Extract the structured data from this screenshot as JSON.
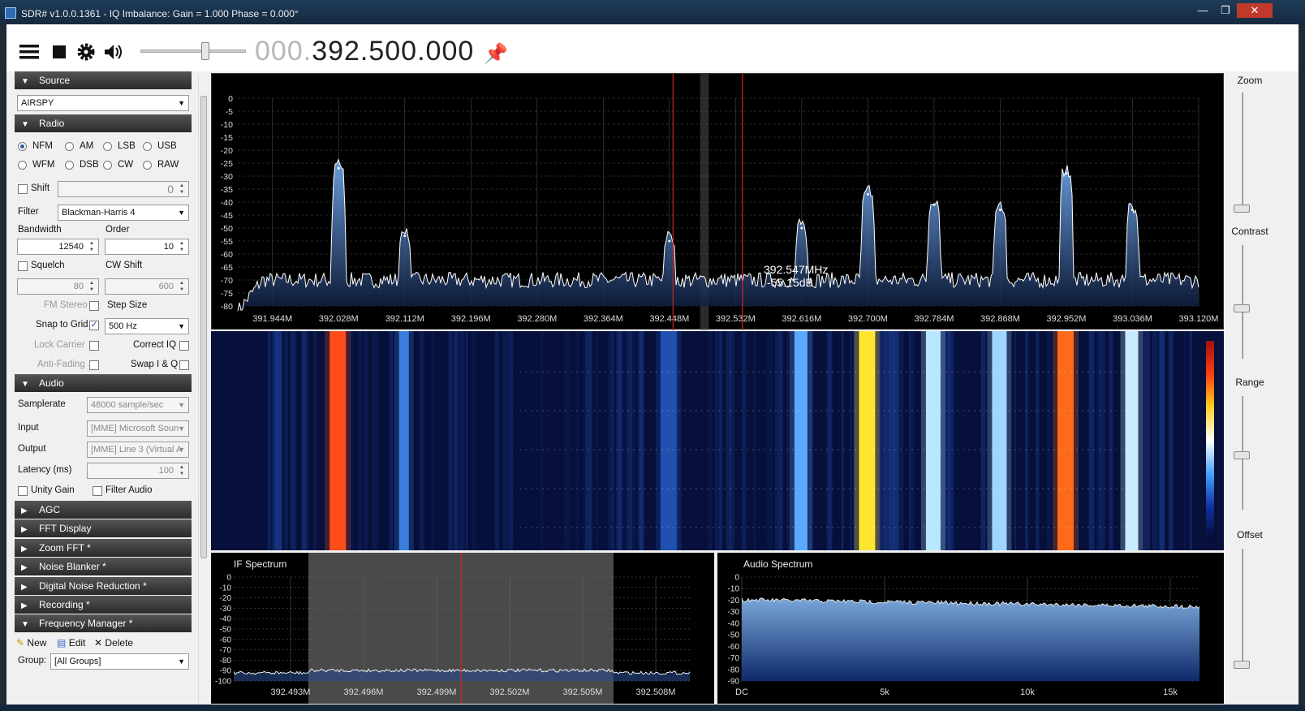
{
  "window": {
    "title": "SDR# v1.0.0.1361 - IQ Imbalance: Gain = 1.000 Phase = 0.000°"
  },
  "toolbar": {
    "icons": [
      "menu-icon",
      "stop-icon",
      "gear-icon",
      "speaker-icon"
    ],
    "freq_dim": "000.",
    "freq_main": "392.500.000",
    "pin_glyph": "📌"
  },
  "source": {
    "header": "Source",
    "device": "AIRSPY"
  },
  "radio": {
    "header": "Radio",
    "modes": [
      "NFM",
      "AM",
      "LSB",
      "USB",
      "WFM",
      "DSB",
      "CW",
      "RAW"
    ],
    "selected_mode": "NFM",
    "shift_label": "Shift",
    "shift_value": "0",
    "filter_label": "Filter",
    "filter_value": "Blackman-Harris 4",
    "bandwidth_label": "Bandwidth",
    "bandwidth_value": "12540",
    "order_label": "Order",
    "order_value": "10",
    "squelch_label": "Squelch",
    "squelch_value": "80",
    "cwshift_label": "CW Shift",
    "cwshift_value": "600",
    "fmstereo_label": "FM Stereo",
    "stepsize_label": "Step Size",
    "snap_label": "Snap to Grid",
    "step_value": "500 Hz",
    "lockcarrier_label": "Lock Carrier",
    "correctiq_label": "Correct IQ",
    "antifading_label": "Anti-Fading",
    "swapiq_label": "Swap I & Q"
  },
  "audio": {
    "header": "Audio",
    "samplerate_label": "Samplerate",
    "samplerate_value": "48000 sample/sec",
    "input_label": "Input",
    "input_value": "[MME] Microsoft Soun",
    "output_label": "Output",
    "output_value": "[MME] Line 3 (Virtual A",
    "latency_label": "Latency (ms)",
    "latency_value": "100",
    "unitygain_label": "Unity Gain",
    "filteraudio_label": "Filter Audio"
  },
  "collapsed": [
    "AGC",
    "FFT Display",
    "Zoom FFT *",
    "Noise Blanker *",
    "Digital Noise Reduction *",
    "Recording *"
  ],
  "freqmgr": {
    "header": "Frequency Manager *",
    "new_label": "New",
    "edit_label": "Edit",
    "delete_label": "Delete",
    "group_label": "Group:",
    "group_value": "[All Groups]"
  },
  "right": {
    "zoom": "Zoom",
    "contrast": "Contrast",
    "range": "Range",
    "offset": "Offset"
  },
  "spectrum": {
    "cursor_freq": "392.547MHz",
    "cursor_db": "-55.15dB",
    "x_ticks": [
      "391.944M",
      "392.028M",
      "392.112M",
      "392.196M",
      "392.280M",
      "392.364M",
      "392.448M",
      "392.532M",
      "392.616M",
      "392.700M",
      "392.784M",
      "392.868M",
      "392.952M",
      "393.036M",
      "393.120M"
    ],
    "y_ticks": [
      "0",
      "-5",
      "-10",
      "-15",
      "-20",
      "-25",
      "-30",
      "-35",
      "-40",
      "-45",
      "-50",
      "-55",
      "-60",
      "-65",
      "-70",
      "-75",
      "-80"
    ]
  },
  "if_spectrum": {
    "title": "IF Spectrum",
    "x_ticks": [
      "392.493M",
      "392.496M",
      "392.499M",
      "392.502M",
      "392.505M",
      "392.508M"
    ],
    "y_ticks": [
      "0",
      "-10",
      "-20",
      "-30",
      "-40",
      "-50",
      "-60",
      "-70",
      "-80",
      "-90",
      "-100"
    ]
  },
  "audio_spectrum": {
    "title": "Audio Spectrum",
    "x_ticks": [
      "DC",
      "5k",
      "10k",
      "15k"
    ],
    "y_ticks": [
      "0",
      "-10",
      "-20",
      "-30",
      "-40",
      "-50",
      "-60",
      "-70",
      "-80",
      "-90"
    ]
  },
  "chart_data": {
    "type": "line",
    "title": "",
    "xlabel": "",
    "ylabel": "",
    "x_unit": "MHz",
    "ylim": [
      -80,
      0
    ],
    "xlim": [
      391.9,
      393.12
    ],
    "peaks": [
      {
        "x": 392.028,
        "y": -27
      },
      {
        "x": 392.112,
        "y": -53
      },
      {
        "x": 392.448,
        "y": -55
      },
      {
        "x": 392.616,
        "y": -50
      },
      {
        "x": 392.7,
        "y": -37
      },
      {
        "x": 392.784,
        "y": -41
      },
      {
        "x": 392.868,
        "y": -43
      },
      {
        "x": 392.952,
        "y": -29
      },
      {
        "x": 393.036,
        "y": -43
      }
    ],
    "noise_floor": -70
  }
}
